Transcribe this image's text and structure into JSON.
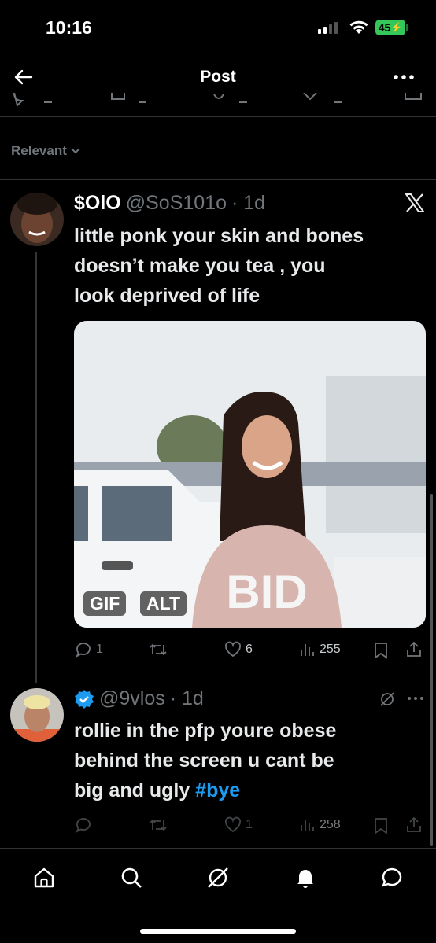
{
  "status_bar": {
    "time": "10:16",
    "battery": "45"
  },
  "header": {
    "title": "Post"
  },
  "filter": {
    "label": "Relevant"
  },
  "tweet1": {
    "name": "$OlO",
    "handle": "@SoS101o",
    "time": "· 1d",
    "lines": [
      "little ponk your skin and bones",
      "doesn’t make you tea , you",
      "look deprived of life"
    ],
    "media_badges": {
      "gif": "GIF",
      "alt": "ALT"
    },
    "stats": {
      "replies": "1",
      "likes": "6",
      "views": "255"
    }
  },
  "tweet2": {
    "handle": "@9vlos",
    "time": "· 1d",
    "lines": [
      "rollie in the pfp youre obese",
      "behind the screen u cant be"
    ],
    "line3_text": "big and ugly ",
    "hashtag": "#bye",
    "stats": {
      "likes": "1",
      "views": "258"
    }
  },
  "colors": {
    "accent": "#1d9bf0",
    "muted": "#71767b",
    "battery": "#34c759"
  },
  "icons": [
    "back-arrow-icon",
    "more-icon",
    "chevron-down-icon",
    "x-logo-icon",
    "reply-icon",
    "retweet-icon",
    "like-icon",
    "views-icon",
    "bookmark-icon",
    "share-icon",
    "verified-icon",
    "grok-icon",
    "home-icon",
    "search-icon",
    "notifications-icon",
    "messages-icon"
  ]
}
